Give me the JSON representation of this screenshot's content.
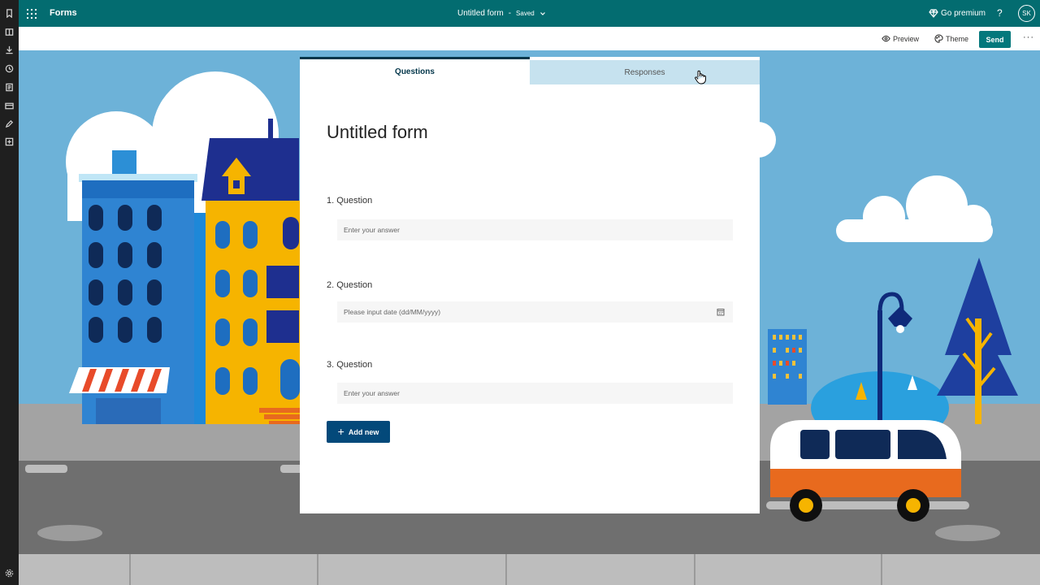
{
  "app": {
    "name": "Forms",
    "form_title": "Untitled form",
    "save_status": "Saved",
    "premium_label": "Go premium",
    "help_label": "?",
    "avatar_initials": "SK"
  },
  "commandbar": {
    "preview_label": "Preview",
    "theme_label": "Theme",
    "send_label": "Send",
    "more_label": "···"
  },
  "tabs": {
    "questions": "Questions",
    "responses": "Responses"
  },
  "form": {
    "title": "Untitled form",
    "questions": [
      {
        "label": "1. Question",
        "placeholder": "Enter your answer"
      },
      {
        "label": "2. Question",
        "placeholder": "Please input date (dd/MM/yyyy)"
      },
      {
        "label": "3. Question",
        "placeholder": "Enter your answer"
      }
    ],
    "add_new_label": "Add new"
  },
  "icons": {
    "left_rail": [
      "bookmark-icon",
      "book-icon",
      "download-icon",
      "history-icon",
      "notes-icon",
      "card-icon",
      "edit-icon",
      "add-box-icon",
      "settings-icon"
    ]
  },
  "colors": {
    "topbar": "#036c70",
    "send": "#03787c",
    "add_new": "#03497a",
    "sky": "#6db2d8"
  }
}
